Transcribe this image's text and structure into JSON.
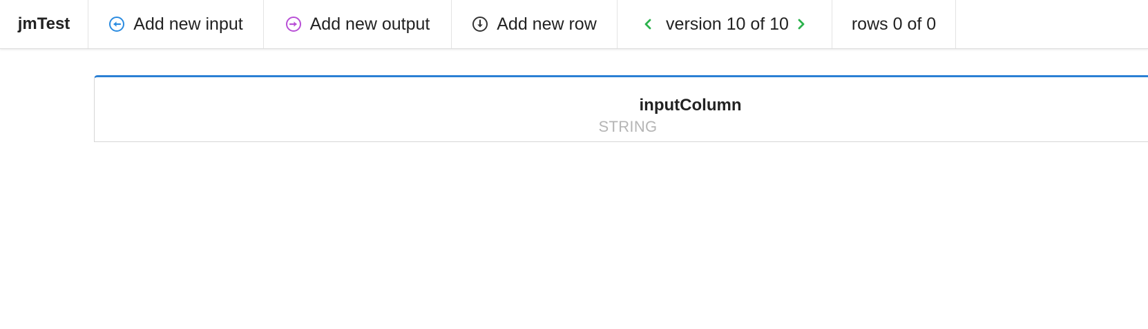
{
  "toolbar": {
    "title": "jmTest",
    "add_input_label": "Add new input",
    "add_output_label": "Add new output",
    "add_row_label": "Add new row",
    "version_label": "version 10 of 10",
    "rows_label": "rows 0 of 0"
  },
  "icons": {
    "add_input": "arrow-left-circle-icon",
    "add_output": "arrow-right-circle-icon",
    "add_row": "arrow-down-circle-icon",
    "prev_version": "chevron-left-icon",
    "next_version": "chevron-right-icon"
  },
  "colors": {
    "input_accent": "#2a8be0",
    "output_accent": "#b84fd6",
    "row_accent": "#333333",
    "version_chevron": "#2bb24c",
    "column_header_border": "#2a7fd4"
  },
  "columns": [
    {
      "name": "inputColumn",
      "type": "STRING"
    }
  ]
}
